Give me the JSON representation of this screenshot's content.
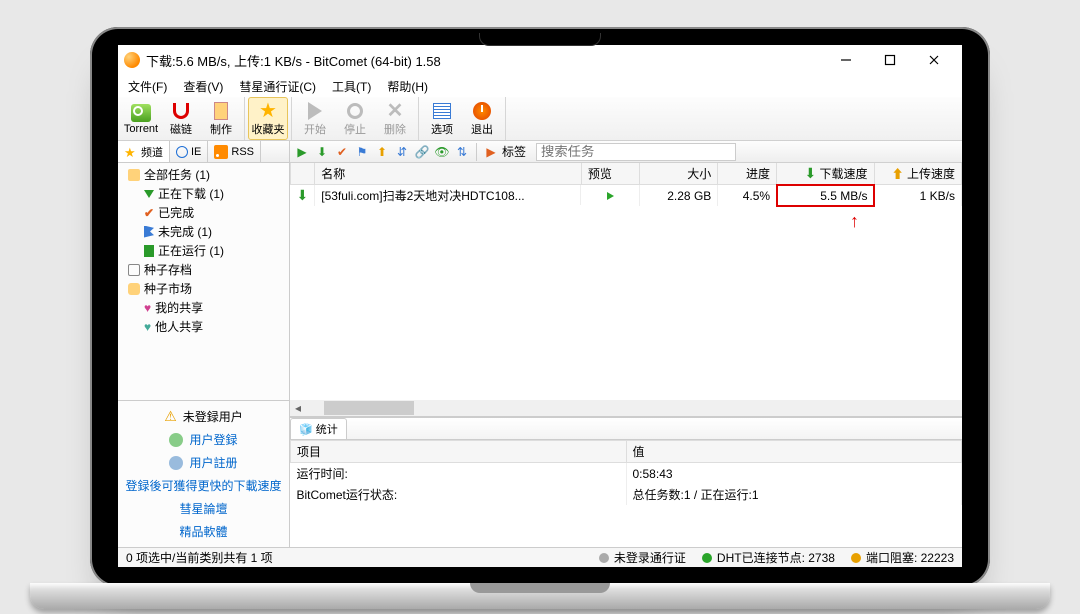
{
  "title": "下载:5.6 MB/s, 上传:1 KB/s - BitComet (64-bit) 1.58",
  "menus": {
    "file": "文件(F)",
    "view": "查看(V)",
    "passport": "彗星通行证(C)",
    "tools": "工具(T)",
    "help": "帮助(H)"
  },
  "toolbar": {
    "torrent": "Torrent",
    "magnet": "磁链",
    "make": "制作",
    "fav": "收藏夹",
    "start": "开始",
    "stop": "停止",
    "delete": "删除",
    "options": "选项",
    "exit": "退出"
  },
  "sideTabs": {
    "channel": "频道",
    "ie": "IE",
    "rss": "RSS"
  },
  "tree": {
    "all": "全部任务 (1)",
    "downloading": "正在下载 (1)",
    "done": "已完成",
    "incomplete": "未完成 (1)",
    "running": "正在运行 (1)",
    "archive": "种子存档",
    "market": "种子市场",
    "my_share": "我的共享",
    "other_share": "他人共享"
  },
  "user": {
    "not_logged": "未登録用户",
    "login": "用户登録",
    "register": "用户註册",
    "faster": "登録後可獲得更快的下載速度",
    "forum": "彗星論壇",
    "software": "精品軟體"
  },
  "smallTb": {
    "tags": "标签"
  },
  "search_placeholder": "搜索任务",
  "grid": {
    "cols": {
      "name": "名称",
      "preview": "预览",
      "size": "大小",
      "progress": "进度",
      "dlspeed": "下载速度",
      "ulspeed": "上传速度"
    },
    "row": {
      "name": "[53fuli.com]扫毒2天地对决HDTC108...",
      "size": "2.28 GB",
      "progress": "4.5%",
      "dlspeed": "5.5 MB/s",
      "ulspeed": "1 KB/s"
    }
  },
  "stats": {
    "tab": "统计",
    "cols": {
      "item": "项目",
      "value": "值"
    },
    "rows": [
      {
        "k": "运行时间:",
        "v": "0:58:43"
      },
      {
        "k": "BitComet运行状态:",
        "v": "总任务数:1 / 正在运行:1"
      }
    ]
  },
  "status": {
    "sel": "0 项选中/当前类别共有 1 项",
    "passport": "未登录通行证",
    "dht": "DHT已连接节点: 2738",
    "port": "端口阻塞: 22223"
  }
}
